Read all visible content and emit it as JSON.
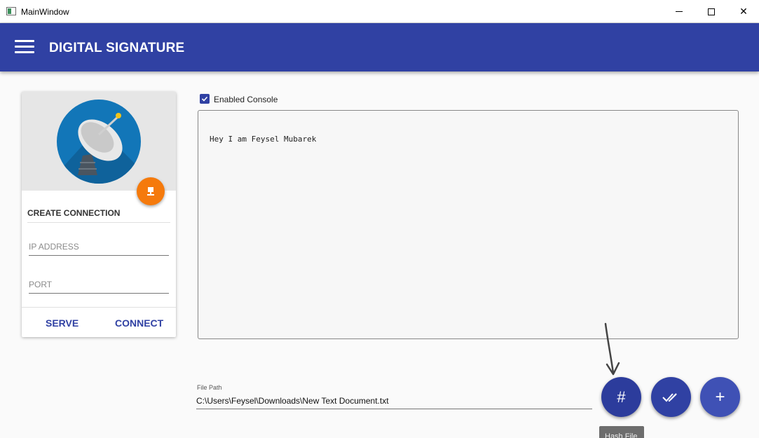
{
  "window": {
    "title": "MainWindow",
    "min_icon": "minimize-icon",
    "max_icon": "maximize-icon",
    "close_glyph": "✕"
  },
  "appbar": {
    "title": "DIGITAL SIGNATURE",
    "color": "#3041a3"
  },
  "card": {
    "heading": "CREATE CONNECTION",
    "ip_placeholder": "IP ADDRESS",
    "port_placeholder": "PORT",
    "serve_label": "SERVE",
    "connect_label": "CONNECT",
    "fab_color": "#f57a0c"
  },
  "console": {
    "checkbox_label": "Enabled Console",
    "checked": true,
    "text": "Hey I am Feysel Mubarek"
  },
  "file": {
    "label": "File Path",
    "value": "C:\\Users\\Feysel\\Downloads\\New Text Document.txt"
  },
  "actions": {
    "hash_glyph": "#",
    "add_glyph": "+",
    "tooltip": "Hash File"
  }
}
